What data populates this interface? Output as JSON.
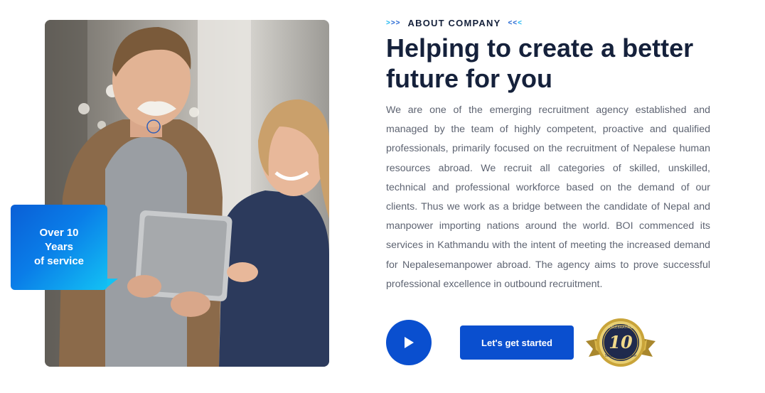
{
  "badge": {
    "line1": "Over 10",
    "line2": "Years",
    "line3": "of service"
  },
  "section": {
    "eyebrow_left_arrows": ">>>",
    "eyebrow": "ABOUT COMPANY",
    "eyebrow_right_arrows": "<<<",
    "headline": "Helping to create a better future for you",
    "body": "We are one of the emerging recruitment agency established and managed by the team of highly competent, proactive and qualified professionals, primarily focused on the recruitment of Nepalese human resources abroad. We recruit all categories of skilled, unskilled, technical and professional workforce based on the demand of our clients. Thus we work as a bridge between the candidate of Nepal and manpower importing nations around the world. BOI commenced its services in Kathmandu with the intent of meeting the increased demand for Nepalesemanpower abroad. The agency aims to prove successful professional excellence in outbound recruitment."
  },
  "actions": {
    "play_icon": "play-icon",
    "cta_label": "Let's get started"
  },
  "seal": {
    "top_text": "CELEBRATING",
    "number": "10",
    "bottom_text": "Years of Service"
  },
  "colors": {
    "primary": "#0a4fcf",
    "heading": "#15213b",
    "body": "#5e6472",
    "accent_light": "#16b4f1",
    "gold": "#c9a43a"
  }
}
